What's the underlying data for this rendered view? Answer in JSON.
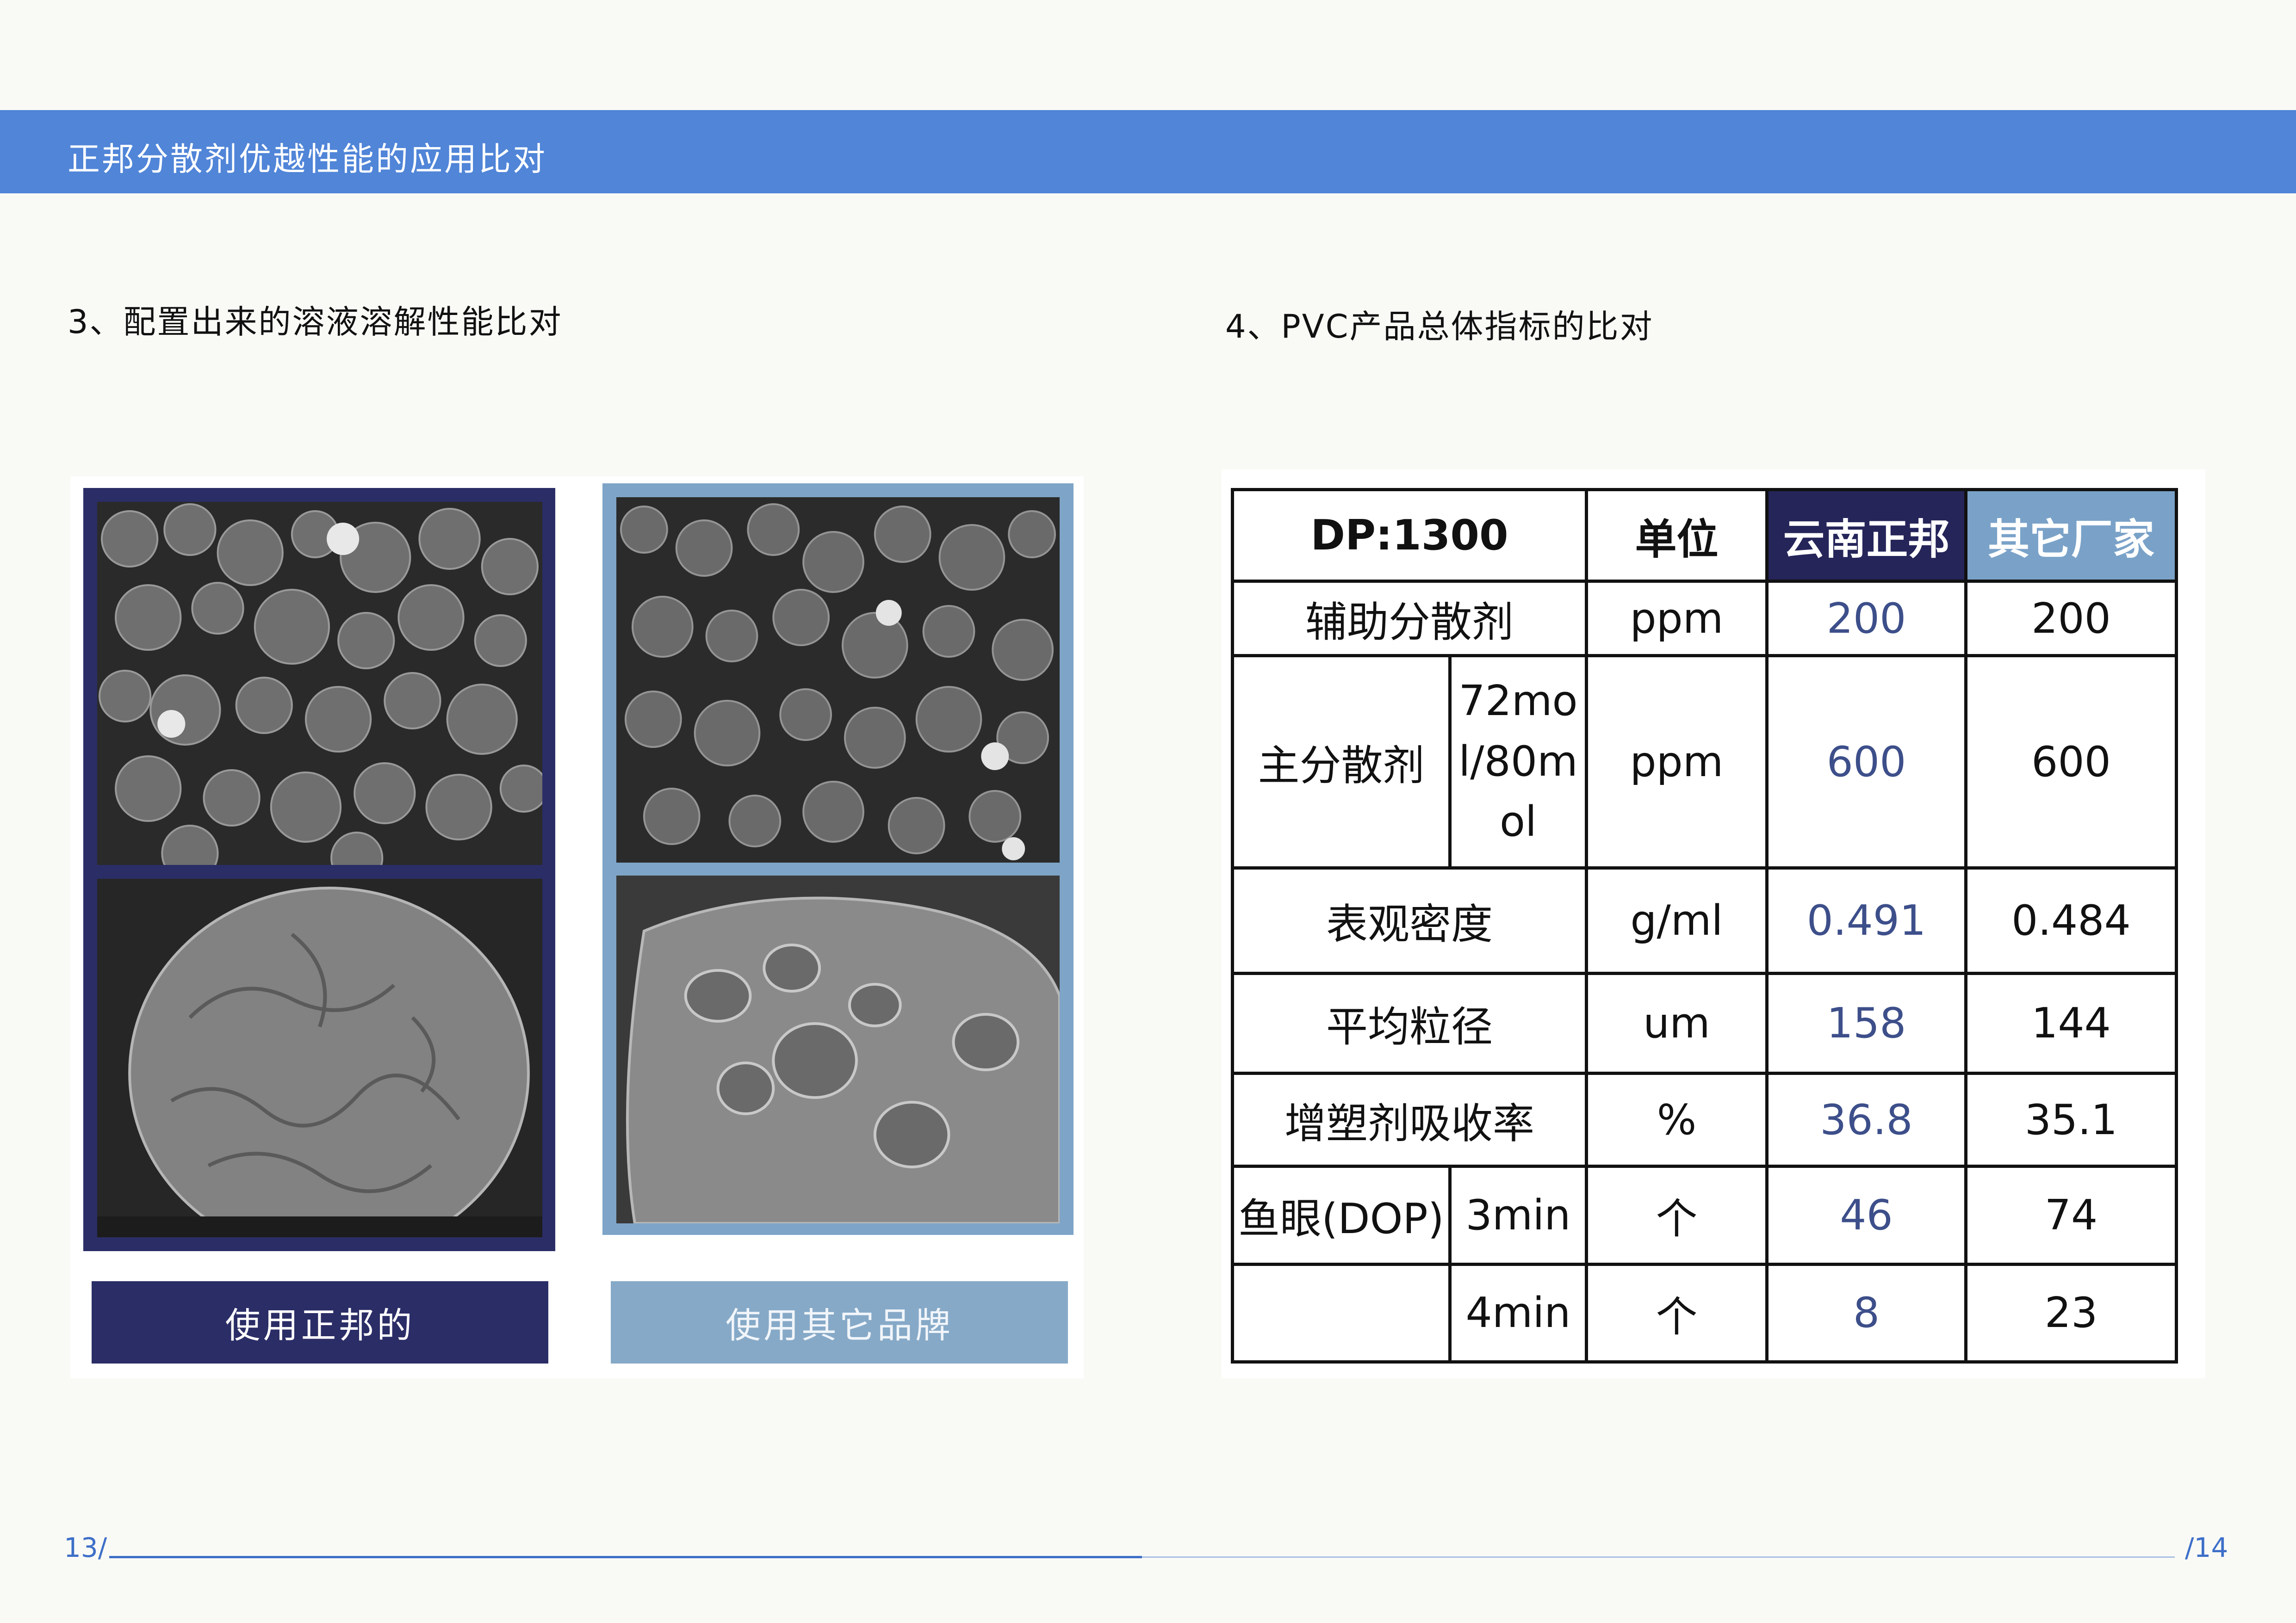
{
  "banner": {
    "title": "正邦分散剂优越性能的应用比对"
  },
  "left_section": {
    "title": "3、配置出来的溶液溶解性能比对",
    "captions": {
      "dark": "使用正邦的",
      "light": "使用其它品牌"
    }
  },
  "right_section": {
    "title": "4、PVC产品总体指标的比对",
    "table": {
      "header": {
        "param": "DP:1300",
        "unit": "单位",
        "col_a": "云南正邦",
        "col_b": "其它厂家"
      },
      "rows": {
        "aux": {
          "name": "辅助分散剂",
          "unit": "ppm",
          "a": "200",
          "b": "200"
        },
        "main": {
          "name": "主分散剂",
          "sub": "72mol/80mol",
          "unit": "ppm",
          "a": "600",
          "b": "600"
        },
        "density": {
          "name": "表观密度",
          "unit": "g/ml",
          "a": "0.491",
          "b": "0.484"
        },
        "particle": {
          "name": "平均粒径",
          "unit": "um",
          "a": "158",
          "b": "144"
        },
        "absorb": {
          "name": "增塑剂吸收率",
          "unit": "%",
          "a": "36.8",
          "b": "35.1"
        },
        "fisheye3": {
          "name": "鱼眼(DOP)",
          "sub": "3min",
          "unit": "个",
          "a": "46",
          "b": "74"
        },
        "fisheye4": {
          "name": "",
          "sub": "4min",
          "unit": "个",
          "a": "8",
          "b": "23"
        }
      }
    }
  },
  "footer": {
    "page_left": "13/",
    "page_right": "/14"
  }
}
